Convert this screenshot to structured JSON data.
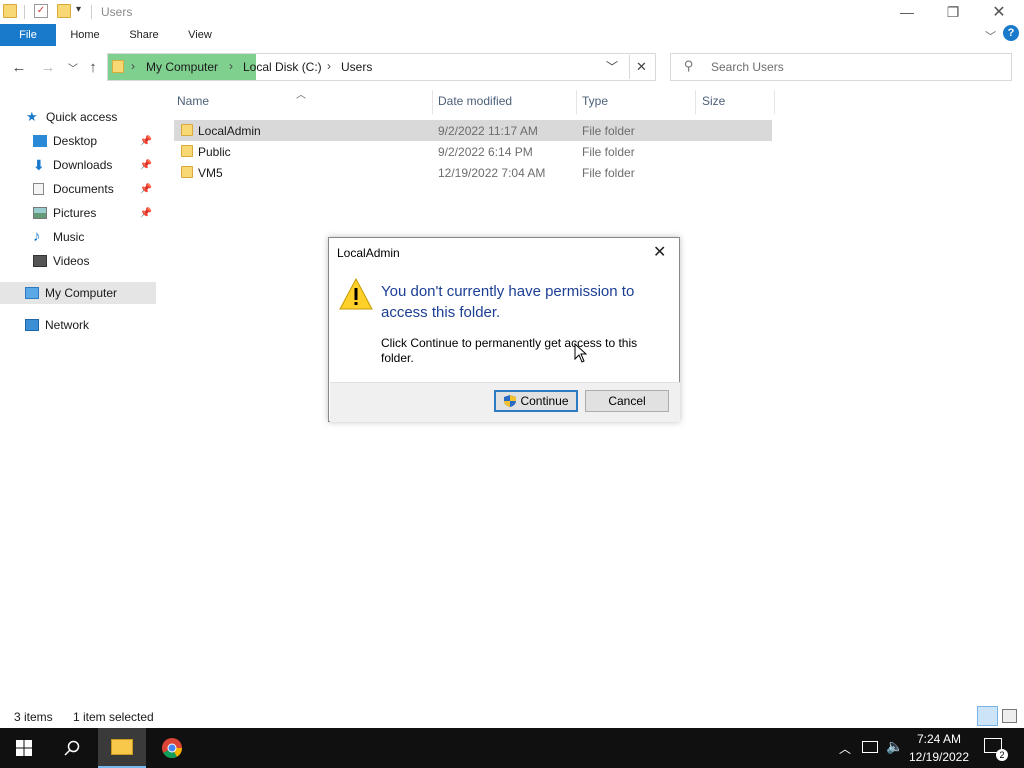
{
  "window": {
    "title": "Users",
    "controls": [
      "minimize",
      "restore",
      "close"
    ]
  },
  "ribbon": {
    "tabs": [
      "File",
      "Home",
      "Share",
      "View"
    ]
  },
  "address_bar": {
    "breadcrumbs": [
      "My Computer",
      "Local Disk (C:)",
      "Users"
    ],
    "search_placeholder": "Search Users"
  },
  "nav_pane": {
    "items": [
      {
        "label": "Quick access",
        "icon": "star-icon",
        "pinned": false
      },
      {
        "label": "Desktop",
        "icon": "desktop-icon",
        "pinned": true
      },
      {
        "label": "Downloads",
        "icon": "download-icon",
        "pinned": true
      },
      {
        "label": "Documents",
        "icon": "documents-icon",
        "pinned": true
      },
      {
        "label": "Pictures",
        "icon": "pictures-icon",
        "pinned": true
      },
      {
        "label": "Music",
        "icon": "music-icon",
        "pinned": false
      },
      {
        "label": "Videos",
        "icon": "videos-icon",
        "pinned": false
      },
      {
        "label": "My Computer",
        "icon": "computer-icon",
        "pinned": false
      },
      {
        "label": "Network",
        "icon": "network-icon",
        "pinned": false
      }
    ]
  },
  "file_list": {
    "columns": [
      "Name",
      "Date modified",
      "Type",
      "Size"
    ],
    "rows": [
      {
        "name": "LocalAdmin",
        "date": "9/2/2022 11:17 AM",
        "type": "File folder",
        "size": ""
      },
      {
        "name": "Public",
        "date": "9/2/2022 6:14 PM",
        "type": "File folder",
        "size": ""
      },
      {
        "name": "VM5",
        "date": "12/19/2022 7:04 AM",
        "type": "File folder",
        "size": ""
      }
    ]
  },
  "status_bar": {
    "item_count": "3 items",
    "selection": "1 item selected"
  },
  "dialog": {
    "title": "LocalAdmin",
    "heading": "You don't currently have permission to access this folder.",
    "body": "Click Continue to permanently get access to this folder.",
    "continue_label": "Continue",
    "cancel_label": "Cancel"
  },
  "taskbar": {
    "time": "7:24 AM",
    "date": "12/19/2022",
    "notification_count": "2"
  },
  "colors": {
    "accent": "#1979ca",
    "address_highlight": "#7fd08f",
    "dialog_heading": "#1c3f94",
    "taskbar": "#101010"
  }
}
